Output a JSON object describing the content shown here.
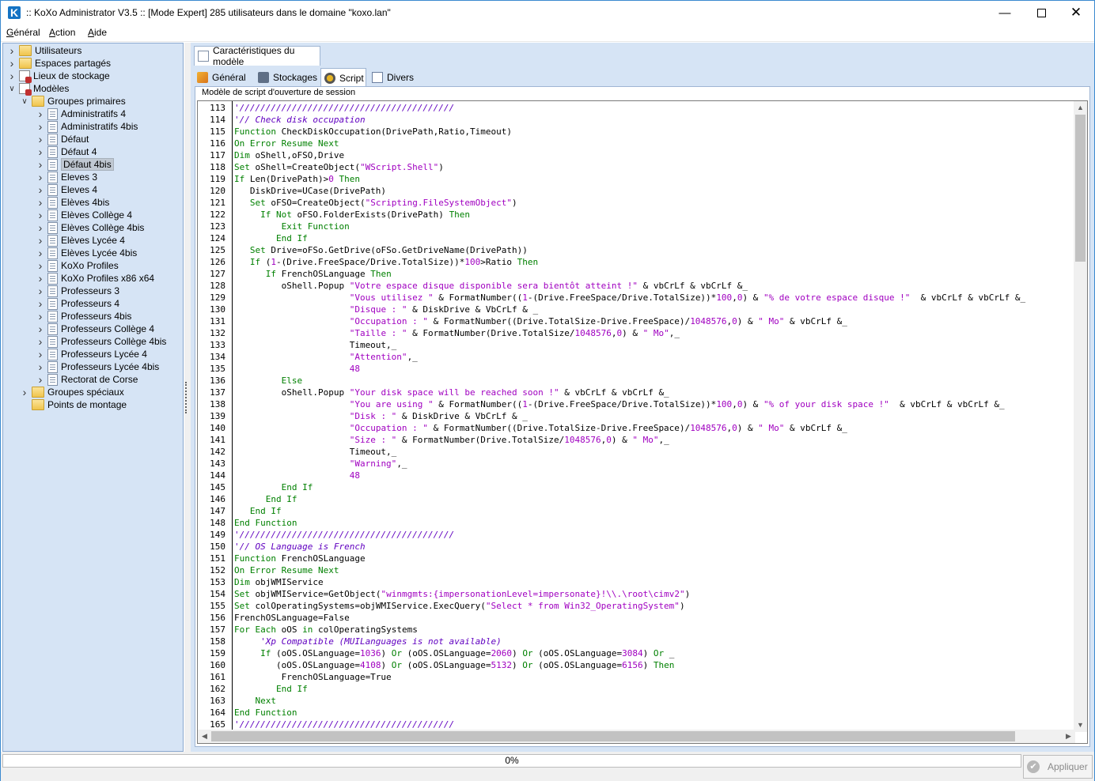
{
  "window": {
    "title": ":: KoXo Administrator V3.5 :: [Mode Expert] 285 utilisateurs dans le domaine \"koxo.lan\"",
    "app_icon_letter": "K"
  },
  "menu": {
    "items": [
      {
        "label": "Général",
        "accel": "G",
        "rest": "énéral"
      },
      {
        "label": "Action",
        "accel": "A",
        "rest": "ction"
      },
      {
        "label": "Aide",
        "accel": "A",
        "rest": "ide"
      }
    ]
  },
  "tree": {
    "items": [
      {
        "label": "Utilisateurs",
        "level": 0,
        "icon": "users-icon",
        "expand": "collapsed"
      },
      {
        "label": "Espaces partagés",
        "level": 0,
        "icon": "shared-folder-icon",
        "expand": "collapsed"
      },
      {
        "label": "Lieux de stockage",
        "level": 0,
        "icon": "storage-icon",
        "expand": "collapsed"
      },
      {
        "label": "Modèles",
        "level": 0,
        "icon": "models-icon",
        "expand": "expanded"
      },
      {
        "label": "Groupes primaires",
        "level": 1,
        "icon": "folder-icon",
        "expand": "expanded"
      },
      {
        "label": "Administratifs 4",
        "level": 2,
        "icon": "model-page-icon",
        "expand": "collapsed"
      },
      {
        "label": "Administratifs 4bis",
        "level": 2,
        "icon": "model-page-icon",
        "expand": "collapsed"
      },
      {
        "label": "Défaut",
        "level": 2,
        "icon": "model-page-icon",
        "expand": "collapsed"
      },
      {
        "label": "Défaut 4",
        "level": 2,
        "icon": "model-page-icon",
        "expand": "collapsed"
      },
      {
        "label": "Défaut 4bis",
        "level": 2,
        "icon": "model-page-icon",
        "expand": "collapsed",
        "selected": true
      },
      {
        "label": "Eleves 3",
        "level": 2,
        "icon": "model-page-icon",
        "expand": "collapsed"
      },
      {
        "label": "Eleves 4",
        "level": 2,
        "icon": "model-page-icon",
        "expand": "collapsed"
      },
      {
        "label": "Elèves 4bis",
        "level": 2,
        "icon": "model-page-icon",
        "expand": "collapsed"
      },
      {
        "label": "Elèves Collège 4",
        "level": 2,
        "icon": "model-page-icon",
        "expand": "collapsed"
      },
      {
        "label": "Elèves Collège 4bis",
        "level": 2,
        "icon": "model-page-icon",
        "expand": "collapsed"
      },
      {
        "label": "Elèves Lycée 4",
        "level": 2,
        "icon": "model-page-icon",
        "expand": "collapsed"
      },
      {
        "label": "Elèves Lycée 4bis",
        "level": 2,
        "icon": "model-page-icon",
        "expand": "collapsed"
      },
      {
        "label": "KoXo Profiles",
        "level": 2,
        "icon": "model-page-icon",
        "expand": "collapsed"
      },
      {
        "label": "KoXo Profiles x86 x64",
        "level": 2,
        "icon": "model-page-icon",
        "expand": "collapsed"
      },
      {
        "label": "Professeurs 3",
        "level": 2,
        "icon": "model-page-icon",
        "expand": "collapsed"
      },
      {
        "label": "Professeurs 4",
        "level": 2,
        "icon": "model-page-icon",
        "expand": "collapsed"
      },
      {
        "label": "Professeurs 4bis",
        "level": 2,
        "icon": "model-page-icon",
        "expand": "collapsed"
      },
      {
        "label": "Professeurs Collège 4",
        "level": 2,
        "icon": "model-page-icon",
        "expand": "collapsed"
      },
      {
        "label": "Professeurs Collège 4bis",
        "level": 2,
        "icon": "model-page-icon",
        "expand": "collapsed"
      },
      {
        "label": "Professeurs Lycée 4",
        "level": 2,
        "icon": "model-page-icon",
        "expand": "collapsed"
      },
      {
        "label": "Professeurs Lycée 4bis",
        "level": 2,
        "icon": "model-page-icon",
        "expand": "collapsed"
      },
      {
        "label": "Rectorat de Corse",
        "level": 2,
        "icon": "model-page-icon",
        "expand": "collapsed"
      },
      {
        "label": "Groupes spéciaux",
        "level": 1,
        "icon": "folder-icon",
        "expand": "collapsed"
      },
      {
        "label": "Points de montage",
        "level": 1,
        "icon": "folder-icon",
        "expand": "none"
      }
    ]
  },
  "outer_tab": {
    "label": "Caractéristiques du modèle"
  },
  "tabs": [
    {
      "label": "Général",
      "icon": "general-icon",
      "active": false
    },
    {
      "label": "Stockages",
      "icon": "storage-icon",
      "active": false
    },
    {
      "label": "Script",
      "icon": "script-icon",
      "active": true
    },
    {
      "label": "Divers",
      "icon": "misc-icon",
      "active": false
    }
  ],
  "script_panel": {
    "caption": "Modèle de script d'ouverture de session",
    "lines": [
      {
        "n": "113",
        "t": "'/////////////////////////////////////////"
      },
      {
        "n": "114",
        "t": "'// Check disk occupation"
      },
      {
        "n": "115",
        "t": "Function CheckDiskOccupation(DrivePath,Ratio,Timeout)"
      },
      {
        "n": "116",
        "t": "On Error Resume Next"
      },
      {
        "n": "117",
        "t": "Dim oShell,oFSO,Drive"
      },
      {
        "n": "118",
        "t": "Set oShell=CreateObject(\"WScript.Shell\")"
      },
      {
        "n": "119",
        "t": "If Len(DrivePath)>0 Then"
      },
      {
        "n": "120",
        "t": "   DiskDrive=UCase(DrivePath)"
      },
      {
        "n": "121",
        "t": "   Set oFSO=CreateObject(\"Scripting.FileSystemObject\")"
      },
      {
        "n": "122",
        "t": "     If Not oFSO.FolderExists(DrivePath) Then"
      },
      {
        "n": "123",
        "t": "         Exit Function"
      },
      {
        "n": "124",
        "t": "        End If"
      },
      {
        "n": "125",
        "t": "   Set Drive=oFSo.GetDrive(oFSo.GetDriveName(DrivePath))"
      },
      {
        "n": "126",
        "t": "   If (1-(Drive.FreeSpace/Drive.TotalSize))*100>Ratio Then"
      },
      {
        "n": "127",
        "t": "      If FrenchOSLanguage Then"
      },
      {
        "n": "128",
        "t": "         oShell.Popup \"Votre espace disque disponible sera bientôt atteint !\" & vbCrLf & vbCrLf &_"
      },
      {
        "n": "129",
        "t": "                      \"Vous utilisez \" & FormatNumber((1-(Drive.FreeSpace/Drive.TotalSize))*100,0) & \"% de votre espace disque !\"  & vbCrLf & vbCrLf &_"
      },
      {
        "n": "130",
        "t": "                      \"Disque : \" & DiskDrive & VbCrLf & _"
      },
      {
        "n": "131",
        "t": "                      \"Occupation : \" & FormatNumber((Drive.TotalSize-Drive.FreeSpace)/1048576,0) & \" Mo\" & vbCrLf &_"
      },
      {
        "n": "132",
        "t": "                      \"Taille : \" & FormatNumber(Drive.TotalSize/1048576,0) & \" Mo\",_"
      },
      {
        "n": "133",
        "t": "                      Timeout,_"
      },
      {
        "n": "134",
        "t": "                      \"Attention\",_"
      },
      {
        "n": "135",
        "t": "                      48"
      },
      {
        "n": "136",
        "t": "         Else"
      },
      {
        "n": "137",
        "t": "         oShell.Popup \"Your disk space will be reached soon !\" & vbCrLf & vbCrLf &_"
      },
      {
        "n": "138",
        "t": "                      \"You are using \" & FormatNumber((1-(Drive.FreeSpace/Drive.TotalSize))*100,0) & \"% of your disk space !\"  & vbCrLf & vbCrLf &_"
      },
      {
        "n": "139",
        "t": "                      \"Disk : \" & DiskDrive & VbCrLf & _"
      },
      {
        "n": "140",
        "t": "                      \"Occupation : \" & FormatNumber((Drive.TotalSize-Drive.FreeSpace)/1048576,0) & \" Mo\" & vbCrLf &_"
      },
      {
        "n": "141",
        "t": "                      \"Size : \" & FormatNumber(Drive.TotalSize/1048576,0) & \" Mo\",_"
      },
      {
        "n": "142",
        "t": "                      Timeout,_"
      },
      {
        "n": "143",
        "t": "                      \"Warning\",_"
      },
      {
        "n": "144",
        "t": "                      48"
      },
      {
        "n": "145",
        "t": "         End If"
      },
      {
        "n": "146",
        "t": "      End If"
      },
      {
        "n": "147",
        "t": "   End If"
      },
      {
        "n": "148",
        "t": "End Function"
      },
      {
        "n": "149",
        "t": "'/////////////////////////////////////////"
      },
      {
        "n": "150",
        "t": "'// OS Language is French"
      },
      {
        "n": "151",
        "t": "Function FrenchOSLanguage"
      },
      {
        "n": "152",
        "t": "On Error Resume Next"
      },
      {
        "n": "153",
        "t": "Dim objWMIService"
      },
      {
        "n": "154",
        "t": "Set objWMIService=GetObject(\"winmgmts:{impersonationLevel=impersonate}!\\\\.\\root\\cimv2\")"
      },
      {
        "n": "155",
        "t": "Set colOperatingSystems=objWMIService.ExecQuery(\"Select * from Win32_OperatingSystem\")"
      },
      {
        "n": "156",
        "t": "FrenchOSLanguage=False"
      },
      {
        "n": "157",
        "t": "For Each oOS in colOperatingSystems"
      },
      {
        "n": "158",
        "t": "     'Xp Compatible (MUILanguages is not available)"
      },
      {
        "n": "159",
        "t": "     If (oOS.OSLanguage=1036) Or (oOS.OSLanguage=2060) Or (oOS.OSLanguage=3084) Or _"
      },
      {
        "n": "160",
        "t": "        (oOS.OSLanguage=4108) Or (oOS.OSLanguage=5132) Or (oOS.OSLanguage=6156) Then"
      },
      {
        "n": "161",
        "t": "         FrenchOSLanguage=True"
      },
      {
        "n": "162",
        "t": "        End If"
      },
      {
        "n": "163",
        "t": "    Next"
      },
      {
        "n": "164",
        "t": "End Function"
      },
      {
        "n": "165",
        "t": "'/////////////////////////////////////////"
      }
    ]
  },
  "status": {
    "progress_text": "0%",
    "progress_value": 0,
    "apply_label": "Appliquer"
  },
  "colors": {
    "accent": "#1473c4",
    "panel_bg": "#d6e4f5",
    "keyword": "#008000",
    "string": "#a000c0",
    "comment": "#6000c0"
  }
}
